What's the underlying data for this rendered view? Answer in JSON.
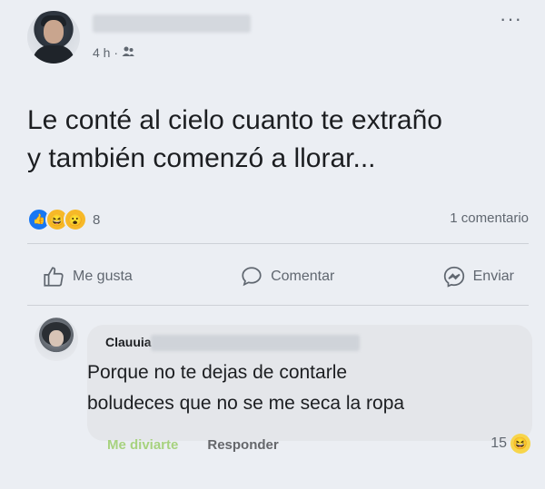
{
  "post": {
    "timestamp": "4 h ·",
    "audience_icon": "friends-icon",
    "text_line1": "Le conté al cielo cuanto te extraño",
    "text_line2": "y también comenzó a llorar...",
    "reaction_count": "8",
    "comment_count": "1 comentario",
    "reactions": [
      "like-icon",
      "haha-icon",
      "wow-icon"
    ]
  },
  "actions": {
    "like_label": "Me gusta",
    "comment_label": "Comentar",
    "share_label": "Enviar"
  },
  "comment": {
    "author_visible": "Clauuia Sa..",
    "text_line1": "Porque no te dejas de contarle",
    "text_line2": "boludeces que no se me seca la ropa",
    "like_label": "Me diviarte",
    "reply_label": "Responder",
    "reaction_count": "15"
  },
  "colors": {
    "background": "#ebeef3",
    "like_blue": "#1877f2",
    "text": "#1c1e21",
    "secondary": "#606770"
  }
}
